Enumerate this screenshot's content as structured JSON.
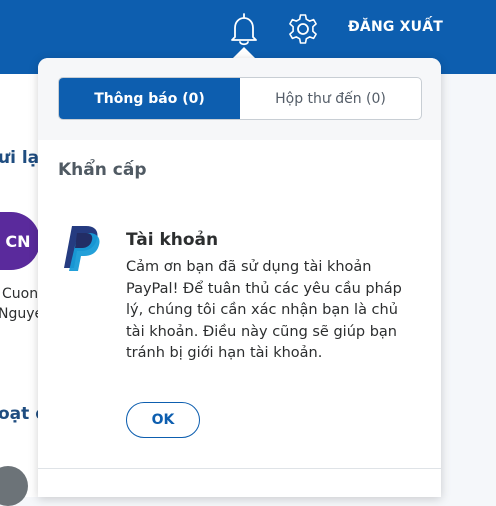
{
  "header": {
    "logout_label": "ĐĂNG XUẤT",
    "bell_icon": "bell-icon",
    "gear_icon": "gear-icon",
    "background_color": "#0d5eaf"
  },
  "background": {
    "text_fragment_1": "ưi lại",
    "avatar_initials": "CN",
    "name_line_1": "Cuong",
    "name_line_2": "Nguye",
    "text_fragment_2": "oạt đ"
  },
  "notifications_panel": {
    "tabs": [
      {
        "label": "Thông báo (0)",
        "active": true
      },
      {
        "label": "Hộp thư đến (0)",
        "active": false
      }
    ],
    "section_title": "Khẩn cấp",
    "card": {
      "icon": "paypal-logo",
      "title": "Tài khoản",
      "body": "Cảm ơn bạn đã sử dụng tài khoản PayPal! Để tuân thủ các yêu cầu pháp lý, chúng tôi cần xác nhận bạn là chủ tài khoản. Điều này cũng sẽ giúp bạn tránh bị giới hạn tài khoản.",
      "ok_label": "OK"
    }
  }
}
